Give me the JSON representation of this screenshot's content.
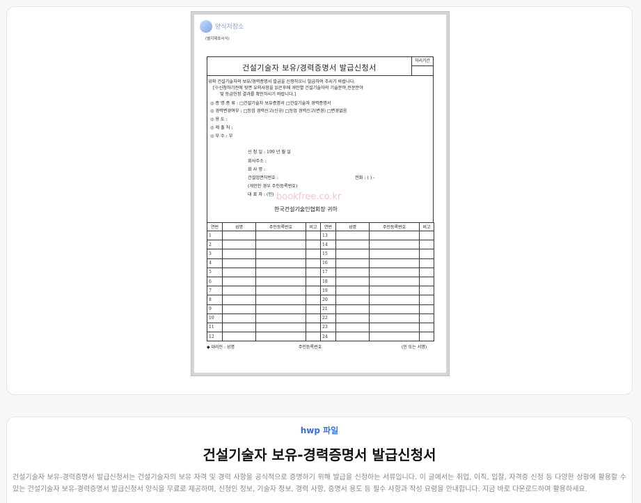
{
  "preview": {
    "logo_text": "양식저장소",
    "form_no": "(별지제호서식)",
    "title": "건설기술자 보유/경력증명서 발급신청서",
    "stamp_label": "처리기간",
    "intro": "위와 건설기술자의 보유/경력증명서 발급을 신청하오니 발급하여 주시기 바랍니다.",
    "note1": "[※신청하기전에 뒷면 유의사항을 읽은후에 개인별 건설기술자의 기술분야,전문분야",
    "note2": "및 등급인정 결과를 확인하시기 바랍니다.]",
    "row_kind": "◎ 증 명 종 류  :  □건설기술자 보유증명서       □건설기술자 경력증명서",
    "row_change": "◎ 경력변경여부 :  □등업 경력신고(신규)     □등업 경력신고(변경)     □변경없음",
    "row_use": "◎ 용          도 :",
    "row_submit": "◎ 제    출    처 :",
    "row_copies": "◎ 부          수 :              부",
    "date_line": "신 청 일 : 199        년          월          일",
    "company_addr": "회사주소 :",
    "company_name": "회 사 명 :",
    "biz_no": "건설업면허번호 :",
    "phone": "전화 : (        )        -",
    "personal_note": "(개인인 경우 주민등록번호)",
    "rep": "대 표 자 :                    (인)",
    "recipient": "한국건설기술인협회장 귀하",
    "watermark": "bookfree.co.kr",
    "table_headers": [
      "연번",
      "성명",
      "주민등록번호",
      "비고",
      "연번",
      "성명",
      "주민등록번호",
      "비고"
    ],
    "left_numbers": [
      "1",
      "2",
      "3",
      "4",
      "5",
      "6",
      "7",
      "8",
      "9",
      "10",
      "11",
      "12"
    ],
    "right_numbers": [
      "13",
      "14",
      "15",
      "16",
      "17",
      "18",
      "19",
      "20",
      "21",
      "22",
      "23",
      "24"
    ],
    "footer_agent": "◆ 대리인 : 성명",
    "footer_id": "주민등록번호",
    "footer_sign": "(인 또는 서명)"
  },
  "info": {
    "file_type": "hwp 파일",
    "title": "건설기술자 보유-경력증명서 발급신청서",
    "description": "건설기술자 보유-경력증명서 발급신청서는 건설기술자의 보유 자격 및 경력 사항을 공식적으로 증명하기 위해 발급을 신청하는 서류입니다. 이 글에서는 취업, 이직, 입찰, 자격증 신청 등 다양한 상황에 활용할 수 있는 건설기술자 보유-경력증명서 발급신청서 양식을 무료로 제공하며, 신청인 정보, 기술자 정보, 경력 사항, 증명서 용도 등 필수 사항과 작성 요령을 안내합니다. 지금 바로 다운로드하여 활용하세요."
  }
}
